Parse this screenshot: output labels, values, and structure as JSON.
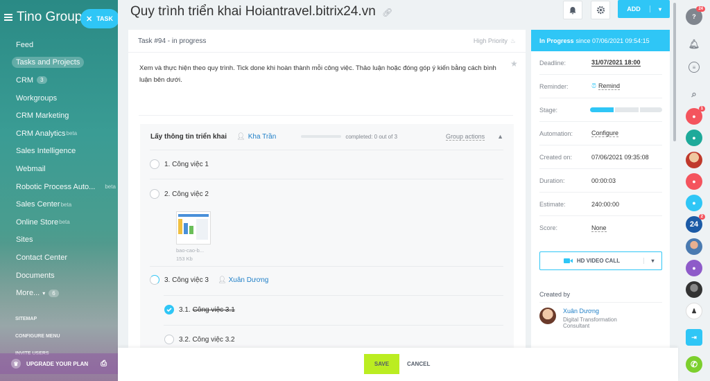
{
  "sidebar": {
    "logo": "Tino Group",
    "task_button": "TASK",
    "items": [
      {
        "label": "Feed"
      },
      {
        "label": "Tasks and Projects",
        "active": true
      },
      {
        "label": "CRM",
        "badge": "3"
      },
      {
        "label": "Workgroups"
      },
      {
        "label": "CRM Marketing"
      },
      {
        "label": "CRM Analytics",
        "beta": "beta"
      },
      {
        "label": "Sales Intelligence"
      },
      {
        "label": "Webmail"
      },
      {
        "label": "Robotic Process Auto...",
        "beta": "beta"
      },
      {
        "label": "Sales Center",
        "beta": "beta"
      },
      {
        "label": "Online Store",
        "beta": "beta"
      },
      {
        "label": "Sites"
      },
      {
        "label": "Contact Center"
      },
      {
        "label": "Documents"
      },
      {
        "label": "More...",
        "badge": "6"
      }
    ],
    "links": [
      "SITEMAP",
      "CONFIGURE MENU",
      "INVITE USERS"
    ],
    "upgrade": "UPGRADE YOUR PLAN"
  },
  "header": {
    "title": "Quy trình triển khai Hoiantravel.bitrix24.vn",
    "add_label": "ADD"
  },
  "task": {
    "heading": "Task #94 - in progress",
    "priority": "High Priority",
    "description": "Xem và thực hiện theo quy trình. Tick done khi hoàn thành mỗi công việc. Thảo luận hoặc đóng góp ý kiến bằng cách bình luận bên dưới."
  },
  "checklist": {
    "title": "Lấy thông tin triển khai",
    "assignee": "Kha Trần",
    "progress": 0,
    "completed": "completed: 0 out of 3",
    "group_actions": "Group actions",
    "items": [
      {
        "label": "1. Công việc 1"
      },
      {
        "label": "2. Công việc 2"
      },
      {
        "label": "3. Công việc 3",
        "user": "Xuân Dương"
      },
      {
        "label": "3.1.",
        "strike": "Công việc 3.1"
      },
      {
        "label": "3.2. Công việc 3.2"
      }
    ],
    "file": {
      "name": "bao-cao-b...",
      "size": "153 Kb"
    }
  },
  "panel": {
    "status_bold": "In Progress",
    "status_rest": "since 07/06/2021 09:54:15",
    "rows": [
      {
        "k": "Deadline:",
        "v": "31/07/2021 18:00"
      },
      {
        "k": "Reminder:",
        "v": "Remind"
      },
      {
        "k": "Stage:",
        "v": ""
      },
      {
        "k": "Automation:",
        "v": "Configure"
      },
      {
        "k": "Created on:",
        "v": "07/06/2021 09:35:08"
      },
      {
        "k": "Duration:",
        "v": "00:00:03"
      },
      {
        "k": "Estimate:",
        "v": "240:00:00"
      },
      {
        "k": "Score:",
        "v": "None"
      }
    ],
    "video_call": "HD VIDEO CALL",
    "created_by": "Created by",
    "creator_name": "Xuân Dương",
    "creator_title_1": "Digital Transformation",
    "creator_title_2": "Consultant"
  },
  "rail": {
    "help_badge": "24",
    "badge_1": "1",
    "badge_24": "24",
    "badge_2": "2"
  },
  "footer": {
    "save": "SAVE",
    "cancel": "CANCEL"
  },
  "colors": {
    "accent": "#2fc6f6",
    "save": "#bbed21",
    "link": "#1f7fc7"
  }
}
